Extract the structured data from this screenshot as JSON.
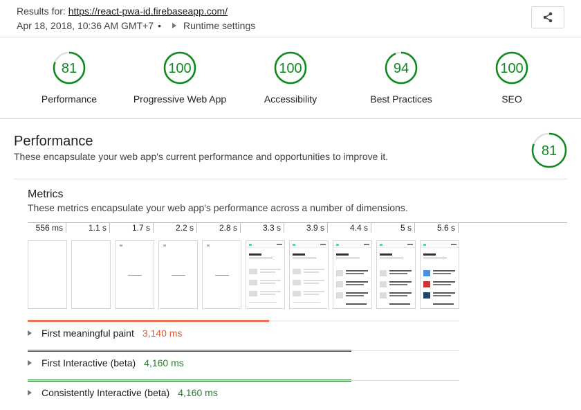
{
  "header": {
    "results_prefix": "Results for:",
    "url": "https://react-pwa-id.firebaseapp.com/",
    "date": "Apr 18, 2018, 10:36 AM GMT+7",
    "separator": "•",
    "runtime_settings": "Runtime settings",
    "share_icon": "share-icon"
  },
  "gauges": [
    {
      "score": "81",
      "label": "Performance",
      "fraction": 0.81,
      "color": "#0c8a1e"
    },
    {
      "score": "100",
      "label": "Progressive Web App",
      "fraction": 1.0,
      "color": "#0c8a1e"
    },
    {
      "score": "100",
      "label": "Accessibility",
      "fraction": 1.0,
      "color": "#0c8a1e"
    },
    {
      "score": "94",
      "label": "Best Practices",
      "fraction": 0.94,
      "color": "#0c8a1e"
    },
    {
      "score": "100",
      "label": "SEO",
      "fraction": 1.0,
      "color": "#0c8a1e"
    }
  ],
  "performance": {
    "title": "Performance",
    "description": "These encapsulate your web app's current performance and opportunities to improve it.",
    "score": "81",
    "fraction": 0.81
  },
  "metrics": {
    "title": "Metrics",
    "description": "These metrics encapsulate your web app's performance across a number of dimensions.",
    "timeline": [
      "556 ms",
      "1.1 s",
      "1.7 s",
      "2.2 s",
      "2.8 s",
      "3.3 s",
      "3.9 s",
      "4.4 s",
      "5 s",
      "5.6 s"
    ],
    "rows": [
      {
        "label": "First meaningful paint",
        "value": "3,140 ms",
        "color": "#e4572e",
        "fraction": 0.56
      },
      {
        "label": "First Interactive (beta)",
        "value": "4,160 ms",
        "color": "#2e7d32",
        "fraction": 0.75
      },
      {
        "label": "Consistently Interactive (beta)",
        "value": "4,160 ms",
        "color": "#2e7d32",
        "fraction": 0.75
      }
    ]
  },
  "colors": {
    "pass": "#0c8a1e",
    "fail": "#e4572e",
    "gauge_track": "#e0e0e0"
  }
}
